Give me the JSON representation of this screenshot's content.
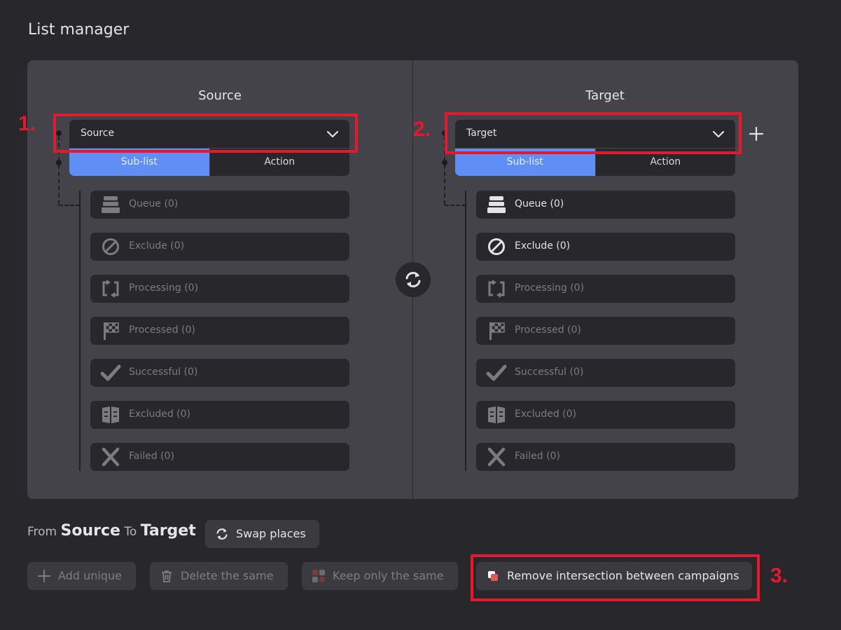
{
  "page": {
    "title": "List manager"
  },
  "source": {
    "heading": "Source",
    "select_value": "Source",
    "tabs": [
      "Sub-list",
      "Action"
    ],
    "active_tab": "Sub-list",
    "items": [
      {
        "label": "Queue (0)",
        "icon": "queue-icon"
      },
      {
        "label": "Exclude (0)",
        "icon": "exclude-icon"
      },
      {
        "label": "Processing (0)",
        "icon": "processing-icon"
      },
      {
        "label": "Processed (0)",
        "icon": "checkered-flag-icon"
      },
      {
        "label": "Successful (0)",
        "icon": "checkmark-icon"
      },
      {
        "label": "Excluded (0)",
        "icon": "excluded-icon"
      },
      {
        "label": "Failed (0)",
        "icon": "x-icon"
      }
    ]
  },
  "target": {
    "heading": "Target",
    "select_value": "Target",
    "tabs": [
      "Sub-list",
      "Action"
    ],
    "active_tab": "Sub-list",
    "items": [
      {
        "label": "Queue (0)",
        "icon": "queue-icon",
        "enabled": true
      },
      {
        "label": "Exclude (0)",
        "icon": "exclude-icon",
        "enabled": true
      },
      {
        "label": "Processing (0)",
        "icon": "processing-icon"
      },
      {
        "label": "Processed (0)",
        "icon": "checkered-flag-icon"
      },
      {
        "label": "Successful (0)",
        "icon": "checkmark-icon"
      },
      {
        "label": "Excluded (0)",
        "icon": "excluded-icon"
      },
      {
        "label": "Failed (0)",
        "icon": "x-icon"
      }
    ]
  },
  "summary": {
    "from_word": "From",
    "source_name": "Source",
    "to_word": "To",
    "target_name": "Target",
    "swap_label": "Swap places"
  },
  "actions": {
    "add_unique": "Add unique",
    "delete_same": "Delete the same",
    "keep_same": "Keep only the same",
    "remove_intersection": "Remove intersection between campaigns"
  },
  "annotations": [
    "1.",
    "2.",
    "3."
  ],
  "colors": {
    "background": "#27272c",
    "panel": "#434349",
    "accent": "#5f8ff5",
    "annotation": "#e3192d"
  }
}
